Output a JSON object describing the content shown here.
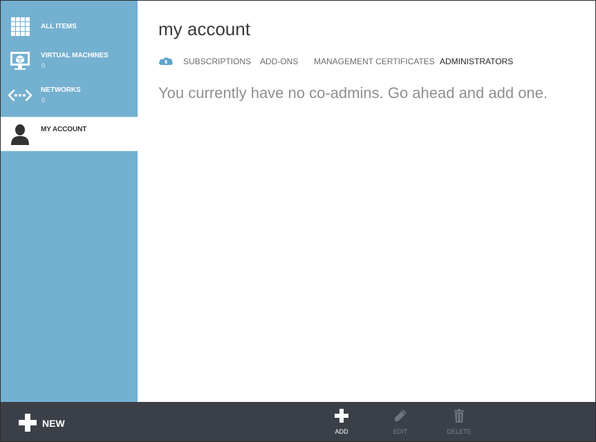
{
  "sidebar": {
    "items": [
      {
        "label": "ALL ITEMS",
        "count": "",
        "icon": "grid-icon",
        "selected": false
      },
      {
        "label": "VIRTUAL MACHINES",
        "count": "0",
        "icon": "monitor-icon",
        "selected": false
      },
      {
        "label": "NETWORKS",
        "count": "0",
        "icon": "network-icon",
        "selected": false
      },
      {
        "label": "MY ACCOUNT",
        "count": "",
        "icon": "user-icon",
        "selected": true
      }
    ]
  },
  "main": {
    "title": "my account",
    "tabs": [
      {
        "label": "SUBSCRIPTIONS",
        "active": false
      },
      {
        "label": "ADD-ONS",
        "active": false
      },
      {
        "label": "MANAGEMENT CERTIFICATES",
        "active": false
      },
      {
        "label": "ADMINISTRATORS",
        "active": true
      }
    ],
    "message": "You currently have no co-admins. Go ahead and add one."
  },
  "commandbar": {
    "new_label": "NEW",
    "commands": [
      {
        "label": "ADD",
        "icon": "plus-icon",
        "enabled": true
      },
      {
        "label": "EDIT",
        "icon": "pencil-icon",
        "enabled": false
      },
      {
        "label": "DELETE",
        "icon": "trash-icon",
        "enabled": false
      }
    ]
  },
  "colors": {
    "sidebar": "#74b0d0",
    "commandbar": "#3b4048",
    "selected_item": "#ffffff",
    "tab_icon": "#5ea3c8",
    "disabled_text": "#7c828a"
  }
}
